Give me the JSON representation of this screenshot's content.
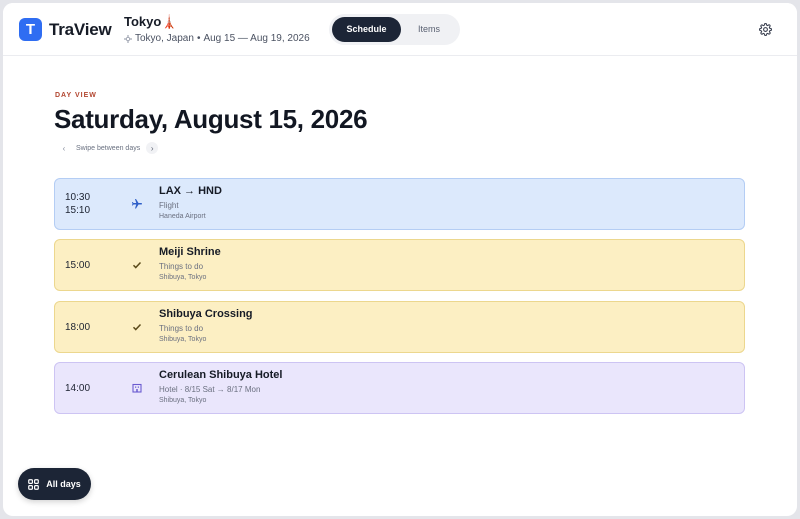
{
  "app": {
    "name": "TraView",
    "logo_letter": "T"
  },
  "trip": {
    "title": "Tokyo🗼",
    "location": "Tokyo, Japan",
    "dates": "Aug 15 — Aug 19, 2026",
    "separator": "•"
  },
  "nav": {
    "schedule": "Schedule",
    "items": "Items",
    "active": "Schedule"
  },
  "day": {
    "label": "DAY VIEW",
    "title": "Saturday, August 15, 2026",
    "swipe_hint": "Swipe between days"
  },
  "events": [
    {
      "kind": "flight",
      "color": "blue",
      "start": "10:30",
      "end": "15:10",
      "icon": "plane-icon",
      "title": "LAX → HND",
      "subtitle": "Flight",
      "location": "Haneda Airport"
    },
    {
      "kind": "todo",
      "color": "yellow",
      "start": "15:00",
      "icon": "check-icon",
      "title": "Meiji Shrine",
      "subtitle": "Things to do",
      "location": "Shibuya, Tokyo"
    },
    {
      "kind": "todo",
      "color": "yellow",
      "start": "18:00",
      "icon": "check-icon",
      "title": "Shibuya Crossing",
      "subtitle": "Things to do",
      "location": "Shibuya, Tokyo"
    },
    {
      "kind": "hotel",
      "color": "purple",
      "start": "14:00",
      "icon": "hotel-icon",
      "title": "Cerulean Shibuya Hotel",
      "subtitle": "Hotel · 8/15 Sat → 8/17 Mon",
      "location": "Shibuya, Tokyo"
    }
  ],
  "fab": {
    "label": "All days"
  },
  "colors": {
    "accent": "#2f6df2",
    "dark": "#1c2536",
    "day_label": "#b2452f",
    "flight_bg": "#dce9fc",
    "todo_bg": "#fcefc3",
    "hotel_bg": "#eae6fc"
  }
}
